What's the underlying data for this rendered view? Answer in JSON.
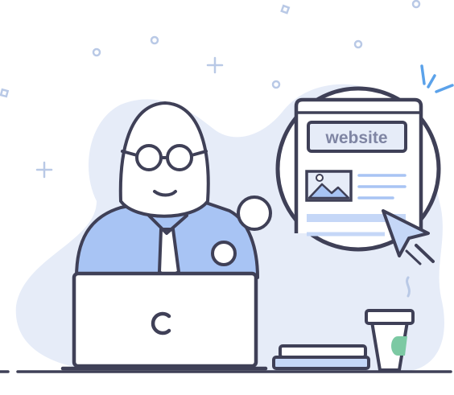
{
  "illustration": {
    "browser_window": {
      "address_text": "website"
    },
    "icons": {
      "person": "man-with-glasses-icon",
      "laptop": "laptop-icon",
      "logo_on_laptop": "c-logo-icon",
      "coffee": "coffee-cup-icon",
      "books": "book-stack-icon",
      "cursor": "mouse-cursor-icon",
      "image": "image-placeholder-icon"
    },
    "colors": {
      "outline": "#3f4057",
      "blob": "#e6ecf8",
      "shirt": "#a8c4f4",
      "highlight": "#c5d7f7",
      "sparkle": "#5ba2ea",
      "accent_green": "#7cc9a3",
      "deco": "#b9c9e6"
    }
  }
}
